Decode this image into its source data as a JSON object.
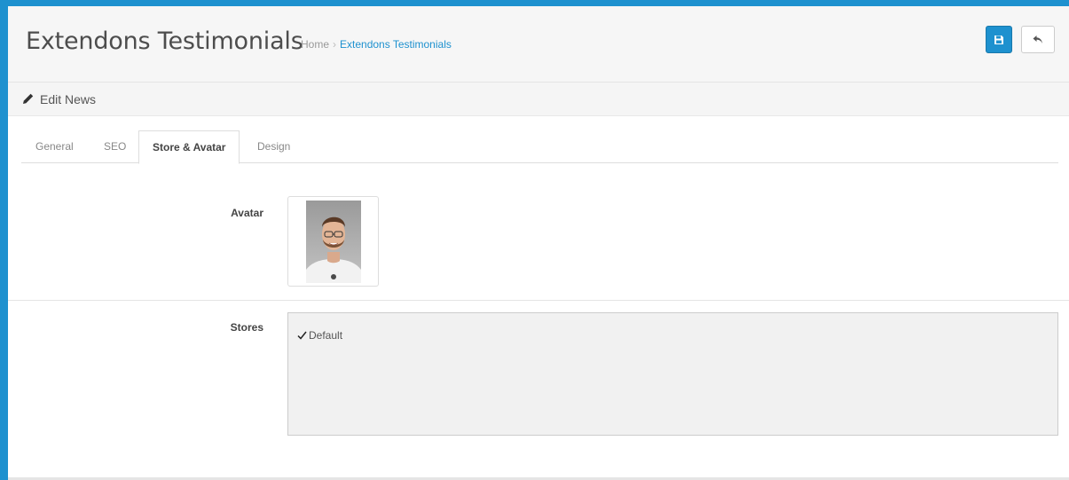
{
  "header": {
    "title": "Extendons Testimonials",
    "breadcrumb": [
      {
        "label": "Home"
      },
      {
        "label": "Extendons Testimonials"
      }
    ],
    "breadcrumb_separator": "›",
    "save_icon": "save-icon",
    "back_icon": "reply-icon"
  },
  "panel": {
    "icon": "pencil-icon",
    "title": "Edit News"
  },
  "tabs": [
    {
      "label": "General",
      "active": false
    },
    {
      "label": "SEO",
      "active": false
    },
    {
      "label": "Store & Avatar",
      "active": true
    },
    {
      "label": "Design",
      "active": false
    }
  ],
  "form": {
    "avatar_label": "Avatar",
    "stores_label": "Stores",
    "stores": [
      {
        "label": "Default",
        "checked": true
      }
    ]
  },
  "colors": {
    "accent": "#1e91cf",
    "header_bg": "#f6f6f6"
  }
}
